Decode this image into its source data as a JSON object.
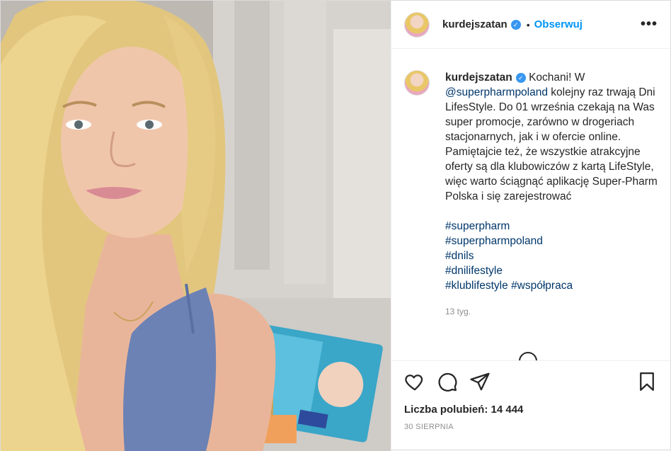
{
  "post": {
    "author": {
      "username": "kurdejszatan",
      "verified_mark": "✓",
      "follow_label": "Obserwuj",
      "more_label": "•••"
    },
    "caption": {
      "username": "kurdejszatan",
      "text_before_mention": "Kochani! W ",
      "mention": "@superpharmpoland",
      "text_after_mention": " kolejny raz trwają Dni LifesStyle. Do 01 września czekają na Was super promocje, zarówno w drogeriach stacjonarnych, jak i w ofercie online. Pamiętajcie też, że wszystkie atrakcyjne oferty są dla klubowiczów z kartą LifeStyle, więc warto ściągnąć aplikację Super-Pharm Polska i się zarejestrować",
      "hashtags": [
        "#superpharm",
        "#superpharmpoland",
        "#dnils",
        "#dnilifestyle",
        "#klublifestyle",
        "#współpraca"
      ]
    },
    "timestamp": "13 tyg.",
    "likes_label": "Liczba polubień:",
    "likes_count": "14 444",
    "date": "30 SIERPNIA",
    "icons": {
      "like": "heart-icon",
      "comment": "comment-icon",
      "share": "share-icon",
      "save": "bookmark-icon",
      "load_more": "plus-circle-icon"
    },
    "colors": {
      "link": "#00376b",
      "follow": "#0095f6",
      "verified": "#3897f0",
      "muted": "#8e8e8e"
    }
  }
}
